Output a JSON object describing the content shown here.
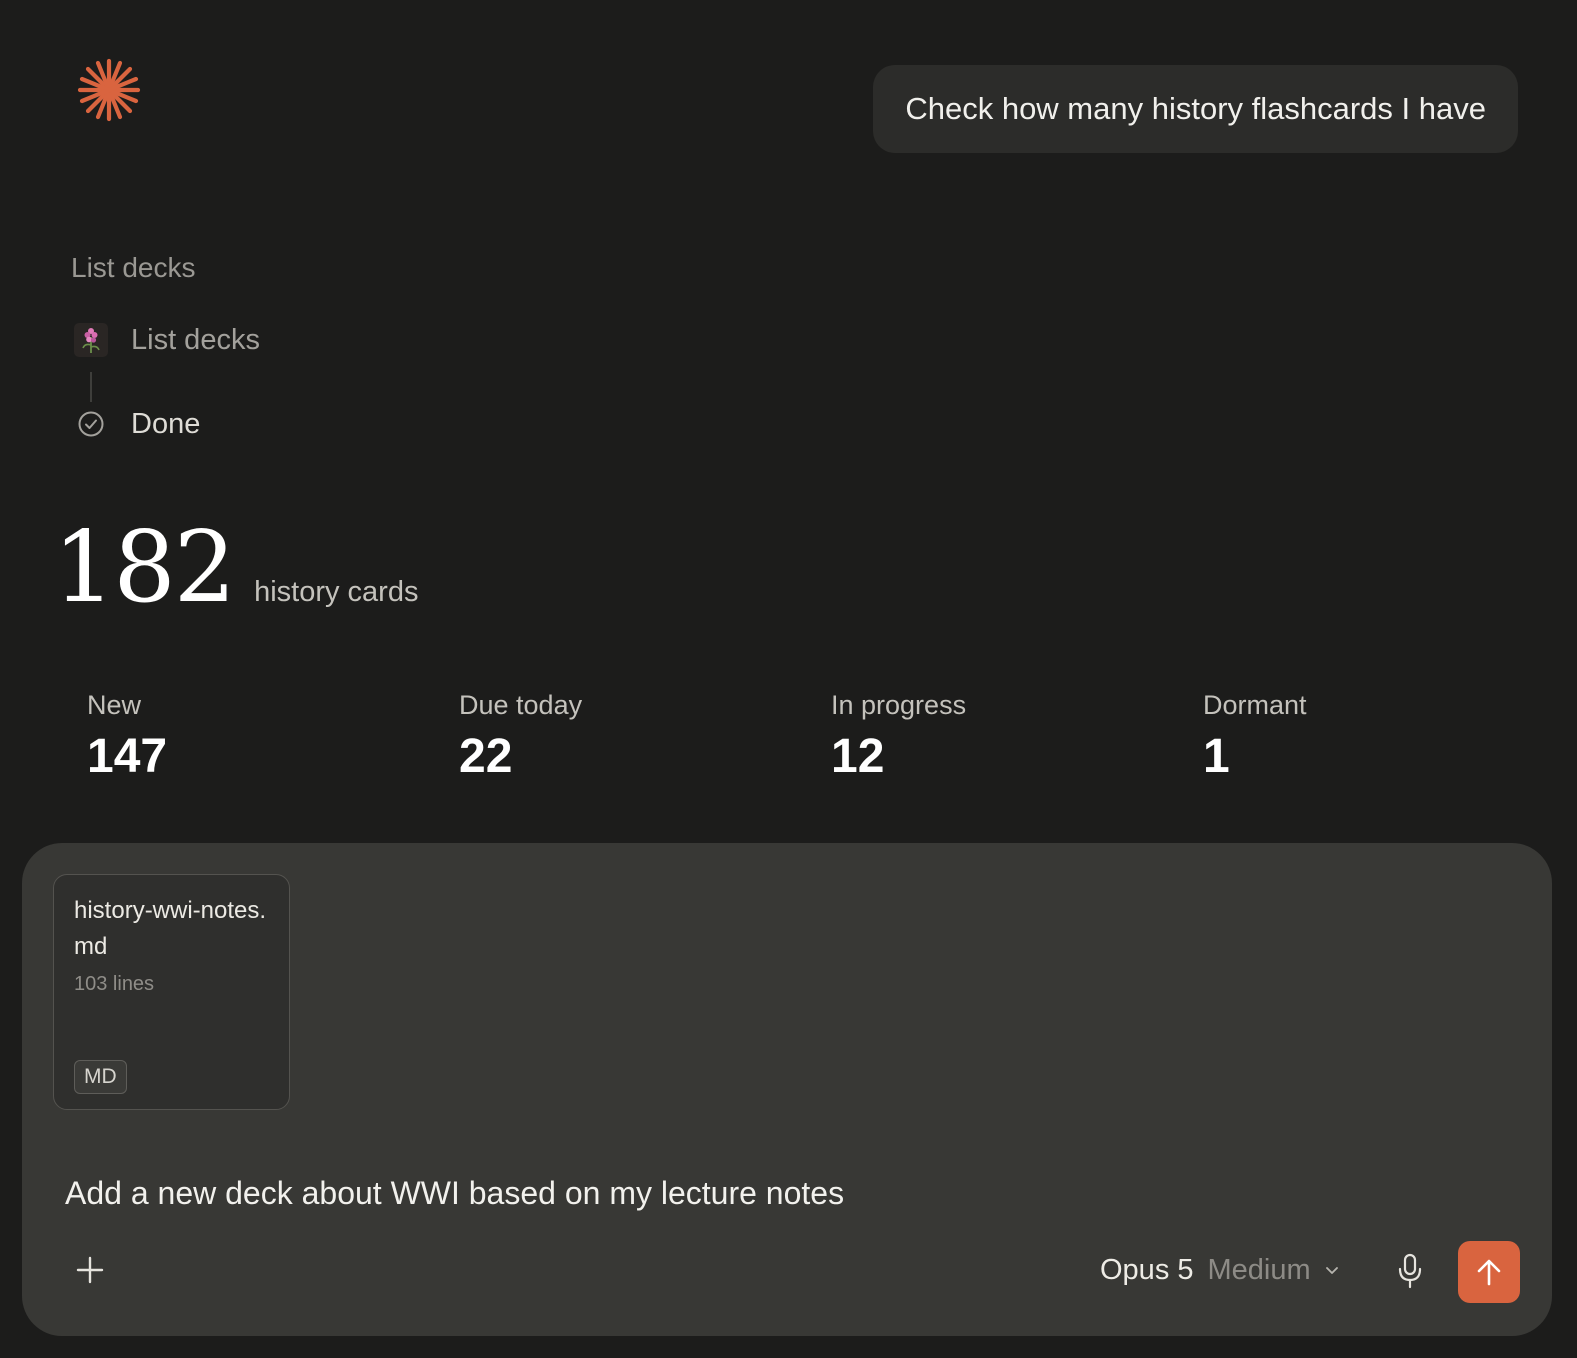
{
  "header": {
    "logo_icon": "asterisk-burst-logo-icon",
    "accent_color": "#d9643f"
  },
  "user_message": {
    "text": "Check how many history flashcards I have"
  },
  "tool_steps": {
    "title": "List decks",
    "items": [
      {
        "label": "List decks",
        "icon": "flower-app-icon"
      },
      {
        "label": "Done",
        "icon": "check-circle-icon"
      }
    ]
  },
  "summary": {
    "count": "182",
    "caption": "history cards"
  },
  "stats": [
    {
      "label": "New",
      "value": "147"
    },
    {
      "label": "Due today",
      "value": "22"
    },
    {
      "label": "In progress",
      "value": "12"
    },
    {
      "label": "Dormant",
      "value": "1"
    }
  ],
  "composer": {
    "attachment": {
      "filename": "history-wwi-notes.md",
      "lines": "103 lines",
      "badge": "MD"
    },
    "input_value": "Add a new deck about WWI based on my lecture notes",
    "model": "Opus 5",
    "effort": "Medium",
    "icons": {
      "add": "plus-icon",
      "dropdown": "chevron-down-icon",
      "mic": "microphone-icon",
      "send": "arrow-up-icon"
    },
    "send_color": "#d9643f"
  }
}
